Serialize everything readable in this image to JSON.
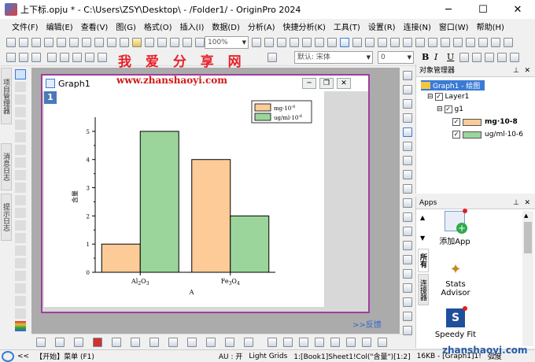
{
  "window": {
    "title": "上下标.opju * - C:\\Users\\ZSY\\Desktop\\ - /Folder1/ - OriginPro 2024",
    "controls": {
      "minimize": "─",
      "maximize": "☐",
      "close": "✕"
    }
  },
  "menu": [
    "文件(F)",
    "编辑(E)",
    "查看(V)",
    "图(G)",
    "格式(O)",
    "插入(I)",
    "数据(D)",
    "分析(A)",
    "快捷分析(K)",
    "工具(T)",
    "设置(R)",
    "连接(N)",
    "窗口(W)",
    "帮助(H)"
  ],
  "toolbar": {
    "zoom": "100%",
    "font_placeholder": "默认: 宋体",
    "font_size": "0",
    "bold": "B",
    "italic": "I",
    "underline": "U"
  },
  "watermark_cn": "我 爱 分 享 网",
  "watermark_url": "www.zhanshaoyi.com",
  "left_tabs": [
    "项目管理器",
    "消息日志",
    "提示日志"
  ],
  "graph_window": {
    "title": "Graph1",
    "layer_number": "1",
    "legend": [
      {
        "label": "mg·10",
        "sup": "-8",
        "color": "#fccb98"
      },
      {
        "label": "ug/ml·10",
        "sup": "-6",
        "color": "#9bd59b"
      }
    ]
  },
  "chart_data": {
    "type": "bar",
    "categories": [
      "Al2O3",
      "Fe3O4"
    ],
    "category_labels": [
      {
        "base": "Al",
        "sub1": "2",
        "mid": "O",
        "sub2": "3"
      },
      {
        "base": "Fe",
        "sub1": "3",
        "mid": "O",
        "sub2": "4"
      }
    ],
    "series": [
      {
        "name": "mg·10-8",
        "values": [
          1,
          4
        ],
        "color": "#fccb98"
      },
      {
        "name": "ug/ml·10-6",
        "values": [
          5,
          2
        ],
        "color": "#9bd59b"
      }
    ],
    "xlabel": "A",
    "ylabel": "含量",
    "ylim": [
      0,
      5.5
    ],
    "yticks": [
      0,
      1,
      2,
      3,
      4,
      5
    ],
    "grid": false,
    "legend_position": "top-right"
  },
  "object_manager": {
    "title": "对象管理器",
    "graph_node": "Graph1 - 绘图",
    "layer_node": "Layer1",
    "group_node": "g1",
    "items": [
      {
        "label": "mg·10-8",
        "color": "#fccb98",
        "bold": true
      },
      {
        "label": "ug/ml·10-6",
        "color": "#9bd59b",
        "bold": false
      }
    ]
  },
  "apps": {
    "title": "Apps",
    "tabs": [
      "所有",
      "连接器"
    ],
    "items": [
      {
        "label": "添加App",
        "icon": "add-app-icon"
      },
      {
        "label": "Stats Advisor",
        "icon": "stats-advisor-icon"
      },
      {
        "label": "Speedy Fit",
        "icon": "speedy-fit-icon"
      }
    ]
  },
  "feedback_link": ">>反馈",
  "statusbar": {
    "start": "【开始】菜单 (F1)",
    "au": "AU : 开",
    "grids": "Light Grids",
    "cell": "1:[Book1]Sheet1!Col(\"含量\")[1:2]",
    "size": "16KB - [Graph1]1!",
    "angle": "弧度"
  },
  "bottom_watermark": "zhanshaoyi.com"
}
